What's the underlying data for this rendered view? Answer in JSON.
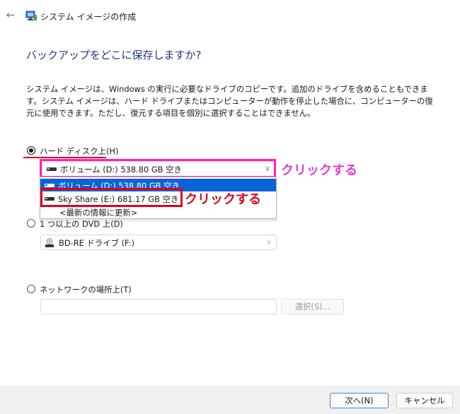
{
  "window": {
    "title": "システム イメージの作成"
  },
  "page": {
    "heading": "バックアップをどこに保存しますか?",
    "description": "システム イメージは、Windows の実行に必要なドライブのコピーです。追加のドライブを含めることもできます。システム イメージは、ハード ドライブまたはコンピューターが動作を停止した場合に、コンピューターの復元に使用できます。ただし、復元する項目を個別に選択することはできません。"
  },
  "options": {
    "hard_disk": {
      "label": "ハード ディスク上(H)",
      "checked": true,
      "selected_value": "ボリューム (D:)  538.80 GB 空き",
      "dropdown_items": [
        {
          "label": "ボリューム (D:)  538.80 GB 空き",
          "selected": true
        },
        {
          "label": "Sky Share (E:)  681.17 GB 空き",
          "selected": false
        },
        {
          "label": "<最新の情報に更新>",
          "selected": false
        }
      ]
    },
    "dvd": {
      "label": "1 つ以上の DVD 上(D)",
      "checked": false,
      "selected_value": "BD-RE ドライブ (F:)"
    },
    "network": {
      "label": "ネットワークの場所上(T)",
      "checked": false,
      "input_value": "",
      "select_button": "選択(S)..."
    }
  },
  "annotations": {
    "click_1": "クリックする",
    "click_2": "クリックする",
    "colors": {
      "magenta": "#ff1fc6",
      "red": "#e0001b"
    }
  },
  "footer": {
    "next_button": "次へ(N)",
    "cancel_button": "キャンセル"
  },
  "icons": {
    "back": "back-arrow-icon",
    "app": "system-image-icon",
    "drive": "drive-icon",
    "dvd": "dvd-drive-icon",
    "chevron": "chevron-down-icon"
  }
}
